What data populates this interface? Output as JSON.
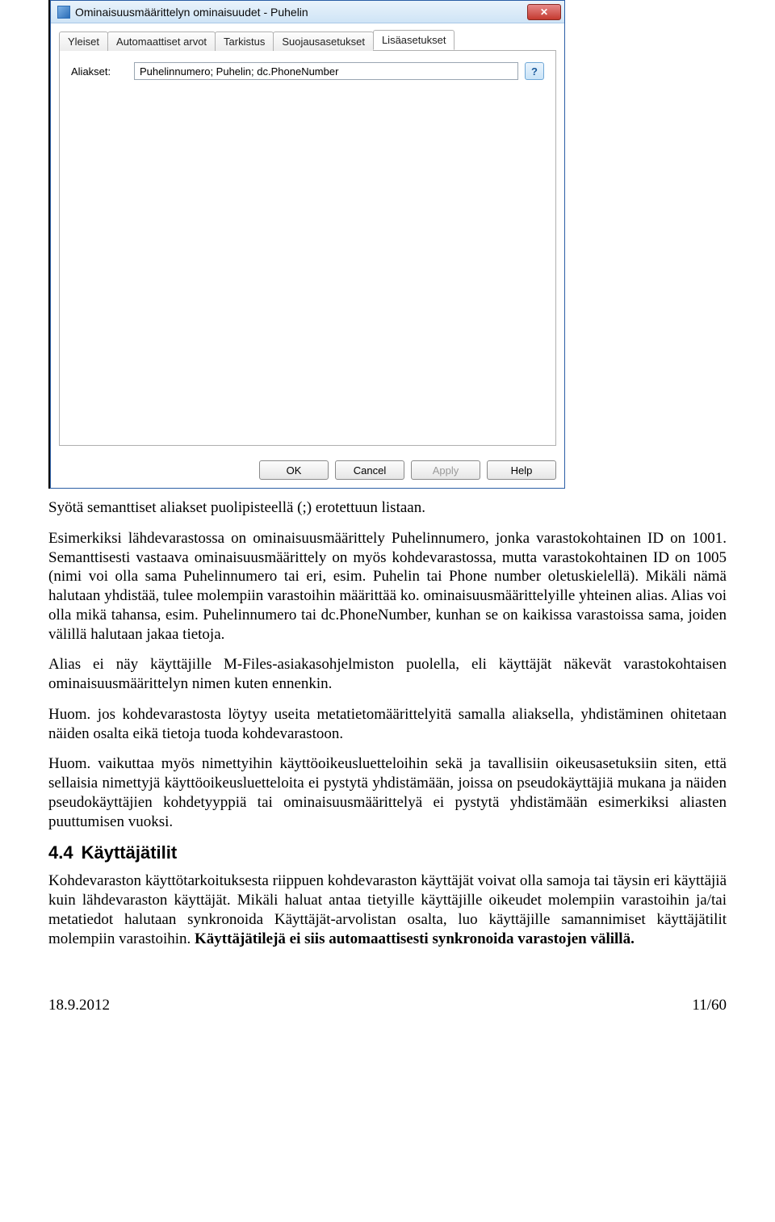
{
  "dialog": {
    "title": "Ominaisuusmäärittelyn ominaisuudet - Puhelin",
    "tabs": [
      "Yleiset",
      "Automaattiset arvot",
      "Tarkistus",
      "Suojausasetukset",
      "Lisäasetukset"
    ],
    "active_tab_index": 4,
    "field_label": "Aliakset:",
    "field_value": "Puhelinnumero; Puhelin; dc.PhoneNumber",
    "help_btn": "?",
    "close_btn": "✕",
    "buttons": {
      "ok": "OK",
      "cancel": "Cancel",
      "apply": "Apply",
      "help": "Help"
    }
  },
  "doc": {
    "p1": "Syötä semanttiset aliakset puolipisteellä (;) erotettuun listaan.",
    "p2": "Esimerkiksi lähdevarastossa on ominaisuusmäärittely Puhelinnumero, jonka varastokohtainen ID on 1001. Semanttisesti vastaava ominaisuusmäärittely on myös kohdevarastossa, mutta varastokohtainen ID on 1005 (nimi voi olla sama Puhelinnumero tai eri, esim. Puhelin tai Phone number oletuskielellä). Mikäli nämä halutaan yhdistää, tulee molempiin varastoihin määrittää ko. ominaisuusmäärittelyille yhteinen alias. Alias voi olla mikä tahansa, esim. Puhelinnumero tai dc.PhoneNumber, kunhan se on kaikissa varastoissa sama, joiden välillä halutaan jakaa tietoja.",
    "p3": "Alias ei näy käyttäjille M-Files-asiakasohjelmiston puolella, eli käyttäjät näkevät varastokohtaisen ominaisuusmäärittelyn nimen kuten ennenkin.",
    "p4": "Huom. jos kohdevarastosta löytyy useita metatietomäärittelyitä samalla aliaksella, yhdistäminen ohitetaan näiden osalta eikä tietoja tuoda kohdevarastoon.",
    "p5": "Huom. vaikuttaa myös nimettyihin käyttöoikeusluetteloihin sekä ja tavallisiin oikeusasetuksiin siten, että sellaisia nimettyjä käyttöoikeusluetteloita ei pystytä yhdistämään, joissa on pseudokäyttäjiä mukana ja näiden pseudokäyttäjien kohdetyyppiä tai ominaisuusmäärittelyä ei pystytä yhdistämään esimerkiksi aliasten puuttumisen vuoksi.",
    "section_num": "4.4",
    "section_title": "Käyttäjätilit",
    "p6a": "Kohdevaraston käyttötarkoituksesta riippuen kohdevaraston käyttäjät voivat olla samoja tai täysin eri käyttäjiä kuin lähdevaraston käyttäjät. Mikäli haluat antaa tietyille käyttäjille oikeudet molempiin varastoihin ja/tai metatiedot halutaan synkronoida Käyttäjät-arvolistan osalta, luo käyttäjille samannimiset käyttäjätilit molempiin varastoihin. ",
    "p6b": "Käyttäjätilejä ei siis automaattisesti synkronoida varastojen välillä."
  },
  "footer": {
    "date": "18.9.2012",
    "page": "11/60"
  }
}
